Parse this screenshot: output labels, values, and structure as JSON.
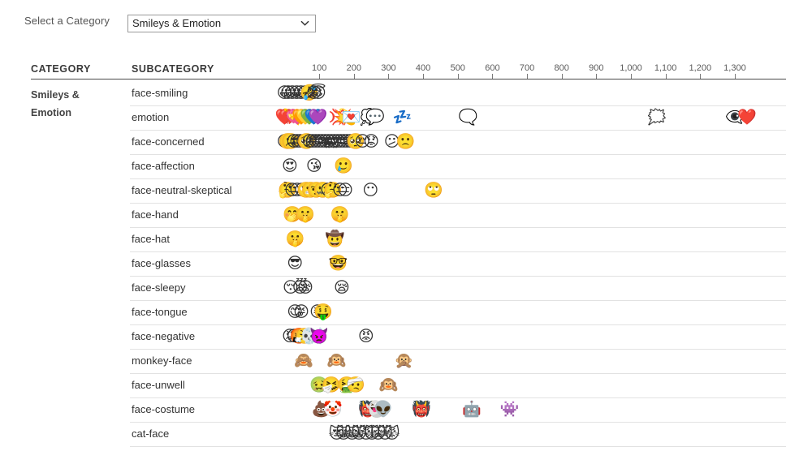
{
  "controls": {
    "select_label": "Select a Category",
    "selected_category": "Smileys & Emotion",
    "options": [
      "Smileys & Emotion"
    ],
    "chevron_icon": "chevron-down-icon"
  },
  "table": {
    "col_category": "CATEGORY",
    "col_subcategory": "SUBCATEGORY",
    "category_name": "Smileys & Emotion"
  },
  "chart_data": {
    "type": "scatter",
    "title": "",
    "xlabel": "",
    "ylabel": "",
    "xlim": [
      0,
      1380
    ],
    "grid": false,
    "legend": false,
    "tick_labels": [
      "100",
      "200",
      "300",
      "400",
      "500",
      "600",
      "700",
      "800",
      "900",
      "1,000",
      "1,100",
      "1,200",
      "1,300"
    ],
    "tick_values": [
      100,
      200,
      300,
      400,
      500,
      600,
      700,
      800,
      900,
      1000,
      1100,
      1200,
      1300
    ],
    "category": "Smileys & Emotion",
    "categories": [
      "face-smiling",
      "emotion",
      "face-concerned",
      "face-affection",
      "face-neutral-skeptical",
      "face-hand",
      "face-hat",
      "face-glasses",
      "face-sleepy",
      "face-tongue",
      "face-negative",
      "monkey-face",
      "face-unwell",
      "face-costume",
      "cat-face"
    ],
    "series": [
      {
        "name": "face-smiling",
        "x": [
          0,
          10,
          22,
          35,
          47,
          60,
          72,
          85,
          97
        ],
        "glyphs": [
          "😀",
          "😃",
          "😄",
          "😁",
          "😆",
          "😅",
          "🤣",
          "😂",
          "😇"
        ]
      },
      {
        "name": "emotion",
        "x": [
          0,
          12,
          24,
          36,
          48,
          60,
          72,
          84,
          96,
          155,
          168,
          180,
          192,
          245,
          262,
          340,
          530,
          1075,
          1300,
          1335
        ],
        "glyphs": [
          "❤️",
          "💔",
          "💘",
          "💝",
          "🧡",
          "💛",
          "💚",
          "💙",
          "💜",
          "💢",
          "💥",
          "💫",
          "💌",
          "💭",
          "💬",
          "💤",
          "🗨️",
          "🗯️",
          "👁️‍🗨️"
        ]
      },
      {
        "name": "face-concerned",
        "x": [
          0,
          9,
          18,
          27,
          36,
          45,
          54,
          63,
          72,
          81,
          90,
          99,
          108,
          117,
          126,
          135,
          144,
          153,
          162,
          171,
          180,
          190,
          205,
          225,
          250,
          310,
          350
        ],
        "glyphs": [
          "😕",
          "🙁",
          "☹️",
          "😮",
          "😯",
          "😲",
          "😳",
          "🥺",
          "😦",
          "😧",
          "😨",
          "😰",
          "😥",
          "😢",
          "😭",
          "😱",
          "😖",
          "😣",
          "😞",
          "😓",
          "😩",
          "😫",
          "🥺",
          "😔",
          "😟"
        ]
      },
      {
        "name": "face-affection",
        "x": [
          15,
          85,
          170
        ],
        "glyphs": [
          "😍",
          "😘",
          "🥲"
        ]
      },
      {
        "name": "face-neutral-skeptical",
        "x": [
          8,
          22,
          36,
          50,
          62,
          75,
          92,
          110,
          125,
          140,
          160,
          175,
          248,
          430
        ],
        "glyphs": [
          "🤔",
          "😐",
          "😑",
          "😶",
          "🙄",
          "😬",
          "🤨",
          "🤐",
          "😒"
        ]
      },
      {
        "name": "face-hand",
        "x": [
          22,
          60,
          160
        ],
        "glyphs": [
          "🤭",
          "🤫",
          "🤫"
        ]
      },
      {
        "name": "face-hat",
        "x": [
          30,
          145
        ],
        "glyphs": [
          "🤫",
          "🤠"
        ]
      },
      {
        "name": "face-glasses",
        "x": [
          30,
          155
        ],
        "glyphs": [
          "😎",
          "🤓"
        ]
      },
      {
        "name": "face-sleepy",
        "x": [
          30,
          45,
          60,
          165
        ],
        "glyphs": [
          "😴",
          "😪",
          "😪",
          "😪"
        ]
      },
      {
        "name": "face-tongue",
        "x": [
          30,
          48,
          95,
          112
        ],
        "glyphs": [
          "😋",
          "😜",
          "😝",
          "🤑"
        ]
      },
      {
        "name": "face-negative",
        "x": [
          15,
          28,
          42,
          58,
          72,
          86,
          100,
          235
        ],
        "glyphs": [
          "😡",
          "😠",
          "🤬",
          "😤",
          "💀",
          "☠️",
          "👿"
        ]
      },
      {
        "name": "monkey-face",
        "x": [
          55,
          150,
          345
        ],
        "glyphs": [
          "🙈",
          "🙉",
          "🙊"
        ]
      },
      {
        "name": "face-unwell",
        "x": [
          100,
          135,
          180,
          205,
          300
        ],
        "glyphs": [
          "🤢",
          "🤧",
          "🤮",
          "🤕",
          "🙉"
        ]
      },
      {
        "name": "face-costume",
        "x": [
          105,
          140,
          240,
          262,
          285,
          395,
          540,
          650
        ],
        "glyphs": [
          "💩",
          "🤡",
          "👹",
          "👻",
          "👽",
          "👹",
          "🤖",
          "👾"
        ]
      },
      {
        "name": "cat-face",
        "x": [
          150,
          170,
          195,
          215,
          235,
          252,
          270,
          290,
          310
        ],
        "glyphs": [
          "😻",
          "😸",
          "😹",
          "😺",
          "😼",
          "😽",
          "🙀",
          "😿",
          "😾"
        ]
      }
    ]
  }
}
